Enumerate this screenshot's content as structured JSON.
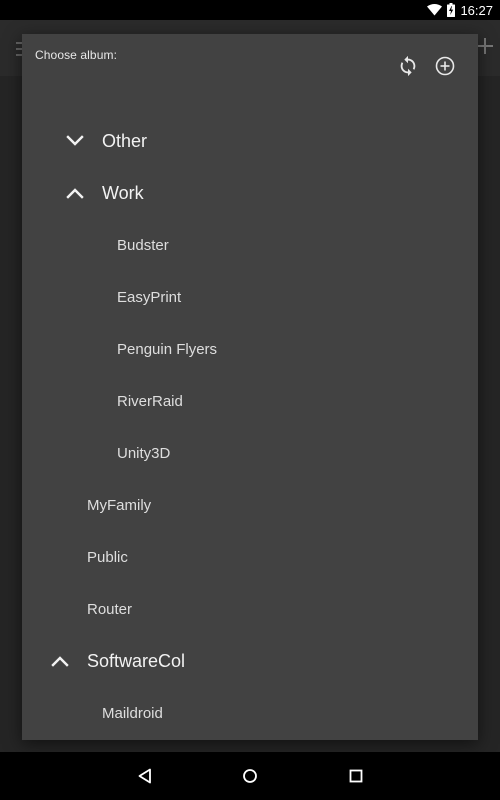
{
  "status_bar": {
    "time": "16:27",
    "icons": [
      "wifi-icon",
      "battery-charging-icon"
    ]
  },
  "dialog": {
    "title": "Choose album:",
    "actions": [
      {
        "name": "refresh",
        "icon": "refresh-icon"
      },
      {
        "name": "add",
        "icon": "add-circle-icon"
      }
    ],
    "albums": [
      {
        "label": "Other",
        "level": 0,
        "expandable": true,
        "expanded": false,
        "icon": "chevron-down-icon"
      },
      {
        "label": "Work",
        "level": 0,
        "expandable": true,
        "expanded": true,
        "icon": "chevron-up-icon"
      },
      {
        "label": "Budster",
        "level": 1,
        "expandable": false
      },
      {
        "label": "EasyPrint",
        "level": 1,
        "expandable": false
      },
      {
        "label": "Penguin Flyers",
        "level": 1,
        "expandable": false
      },
      {
        "label": "RiverRaid",
        "level": 1,
        "expandable": false
      },
      {
        "label": "Unity3D",
        "level": 1,
        "expandable": false
      },
      {
        "label": "MyFamily",
        "level": 0,
        "expandable": false
      },
      {
        "label": "Public",
        "level": 0,
        "expandable": false
      },
      {
        "label": "Router",
        "level": 0,
        "expandable": false
      },
      {
        "label": "SoftwareCol",
        "level": 0,
        "expandable": true,
        "expanded": true,
        "icon": "chevron-up-icon"
      },
      {
        "label": "Maildroid",
        "level": 1,
        "expandable": false
      }
    ]
  },
  "nav_bar": {
    "buttons": [
      "back-icon",
      "home-icon",
      "recents-icon"
    ]
  },
  "colors": {
    "dialog_bg": "#424242",
    "text": "#e8e8e8",
    "status_bar": "#000000"
  }
}
